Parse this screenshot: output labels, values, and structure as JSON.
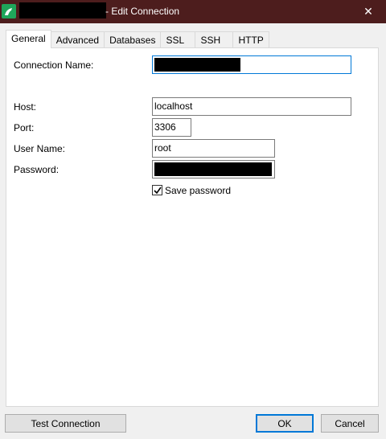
{
  "window": {
    "title": "- Edit Connection",
    "close_glyph": "✕"
  },
  "tabs": [
    {
      "label": "General",
      "active": true
    },
    {
      "label": "Advanced",
      "active": false
    },
    {
      "label": "Databases",
      "active": false
    },
    {
      "label": "SSL",
      "active": false
    },
    {
      "label": "SSH",
      "active": false
    },
    {
      "label": "HTTP",
      "active": false
    }
  ],
  "form": {
    "connection_name_label": "Connection Name:",
    "host_label": "Host:",
    "host_value": "localhost",
    "port_label": "Port:",
    "port_value": "3306",
    "username_label": "User Name:",
    "username_value": "root",
    "password_label": "Password:",
    "save_password_label": "Save password",
    "save_password_checked": true
  },
  "buttons": {
    "test_connection": "Test Connection",
    "ok": "OK",
    "cancel": "Cancel"
  },
  "colors": {
    "titlebar": "#4d1d1d",
    "focus_accent": "#0078d7",
    "app_icon": "#1fa65a"
  },
  "icons": {
    "app": "dolphin-app-icon",
    "close": "close-icon",
    "checkbox": "checkmark-icon"
  }
}
